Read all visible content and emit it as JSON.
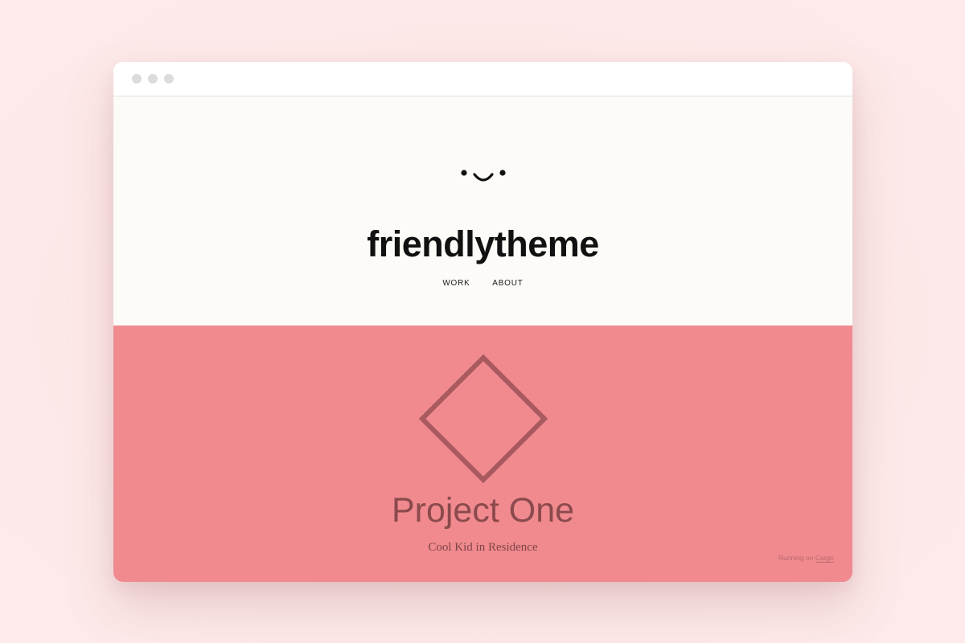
{
  "site": {
    "title": "friendlytheme",
    "logo_icon": "smiley-face-icon"
  },
  "nav": {
    "items": [
      {
        "label": "WORK"
      },
      {
        "label": "ABOUT"
      }
    ]
  },
  "project": {
    "title": "Project One",
    "subtitle": "Cool Kid in Residence",
    "icon": "diamond-outline-icon"
  },
  "footer": {
    "prefix": "Running on",
    "link_label": "Cargo"
  },
  "colors": {
    "page_background": "#fde8e8",
    "header_background": "#fcfbf7",
    "project_background": "#f08a8f",
    "project_accent": "#8b4a4c"
  }
}
